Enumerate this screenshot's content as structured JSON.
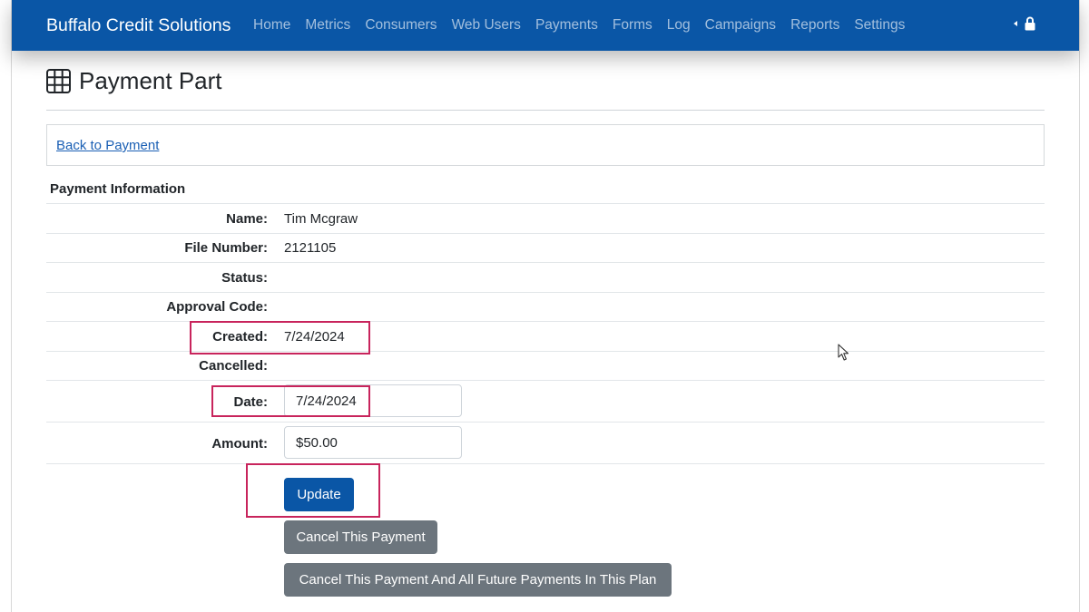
{
  "navbar": {
    "brand": "Buffalo Credit Solutions",
    "links": [
      "Home",
      "Metrics",
      "Consumers",
      "Web Users",
      "Payments",
      "Forms",
      "Log",
      "Campaigns",
      "Reports",
      "Settings"
    ],
    "right_icons": [
      "caret-left-icon",
      "lock-icon"
    ]
  },
  "page": {
    "title": "Payment Part",
    "title_icon": "table-grid-icon",
    "back_link": "Back to Payment"
  },
  "payment_info": {
    "section_title": "Payment Information",
    "name_label": "Name:",
    "name_value": "Tim Mcgraw",
    "file_number_label": "File Number:",
    "file_number_value": "2121105",
    "status_label": "Status:",
    "status_value": "",
    "approval_code_label": "Approval Code:",
    "approval_code_value": "",
    "created_label": "Created:",
    "created_value": "7/24/2024",
    "cancelled_label": "Cancelled:",
    "cancelled_value": "",
    "date_label": "Date:",
    "date_value": "7/24/2024",
    "amount_label": "Amount:",
    "amount_value": "$50.00"
  },
  "buttons": {
    "update": "Update",
    "cancel_payment": "Cancel This Payment",
    "cancel_all": "Cancel This Payment And All Future Payments In This Plan"
  },
  "colors": {
    "navbar": "#0a56a6",
    "primary_button": "#0a56a6",
    "secondary_button": "#6c757d",
    "highlight": "#c8245c",
    "link": "#1a5fb4"
  }
}
